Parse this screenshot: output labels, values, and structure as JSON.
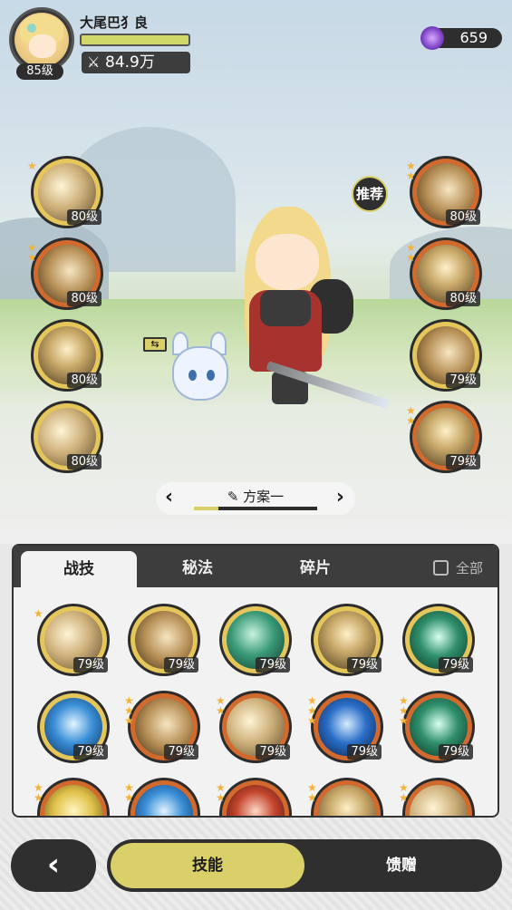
{
  "player": {
    "name": "大尾巴犭良",
    "level": "85级",
    "power": "84.9万",
    "exp_fraction": 1.0
  },
  "currency": {
    "gems": "659",
    "icon": "purple-crystal-icon"
  },
  "equipped_left": [
    {
      "level": "80级",
      "stars": 1,
      "ring": "gold"
    },
    {
      "level": "80级",
      "stars": 2,
      "ring": "orange"
    },
    {
      "level": "80级",
      "stars": 0,
      "ring": "gold"
    },
    {
      "level": "80级",
      "stars": 0,
      "ring": "gold"
    }
  ],
  "equipped_right": [
    {
      "level": "80级",
      "stars": 2,
      "ring": "orange"
    },
    {
      "level": "80级",
      "stars": 2,
      "ring": "orange"
    },
    {
      "level": "79级",
      "stars": 0,
      "ring": "gold"
    },
    {
      "level": "79级",
      "stars": 2,
      "ring": "orange"
    }
  ],
  "recommend_label": "推荐",
  "swap_label": "⇆",
  "plan": {
    "label": "方案一",
    "prev_icon": "chevron-left-icon",
    "next_icon": "chevron-right-icon",
    "edit_icon": "pencil-icon",
    "progress": 0.2
  },
  "tabs": [
    "战技",
    "秘法",
    "碎片"
  ],
  "select_all_label": "全部",
  "skill_grid": [
    [
      {
        "level": "79级",
        "stars": 1,
        "ring": "gold"
      },
      {
        "level": "79级",
        "stars": 0,
        "ring": "gold"
      },
      {
        "level": "79级",
        "stars": 0,
        "ring": "gold"
      },
      {
        "level": "79级",
        "stars": 0,
        "ring": "gold"
      },
      {
        "level": "79级",
        "stars": 0,
        "ring": "gold"
      }
    ],
    [
      {
        "level": "79级",
        "stars": 0,
        "ring": "gold"
      },
      {
        "level": "79级",
        "stars": 3,
        "ring": "orange"
      },
      {
        "level": "79级",
        "stars": 2,
        "ring": "orange"
      },
      {
        "level": "79级",
        "stars": 3,
        "ring": "orange"
      },
      {
        "level": "79级",
        "stars": 3,
        "ring": "orange"
      }
    ],
    [
      {
        "level": "",
        "stars": 2,
        "ring": "orange"
      },
      {
        "level": "",
        "stars": 2,
        "ring": "orange"
      },
      {
        "level": "",
        "stars": 2,
        "ring": "orange"
      },
      {
        "level": "",
        "stars": 2,
        "ring": "orange"
      },
      {
        "level": "",
        "stars": 2,
        "ring": "orange"
      }
    ]
  ],
  "nav": {
    "back_icon": "chevron-left-icon",
    "skill_label": "技能",
    "gift_label": "馈赠"
  },
  "colors": {
    "accent": "#d9d06a",
    "dark": "#2f2f2f",
    "gold_ring": "#e4c65a",
    "orange_ring": "#d36a2d"
  }
}
